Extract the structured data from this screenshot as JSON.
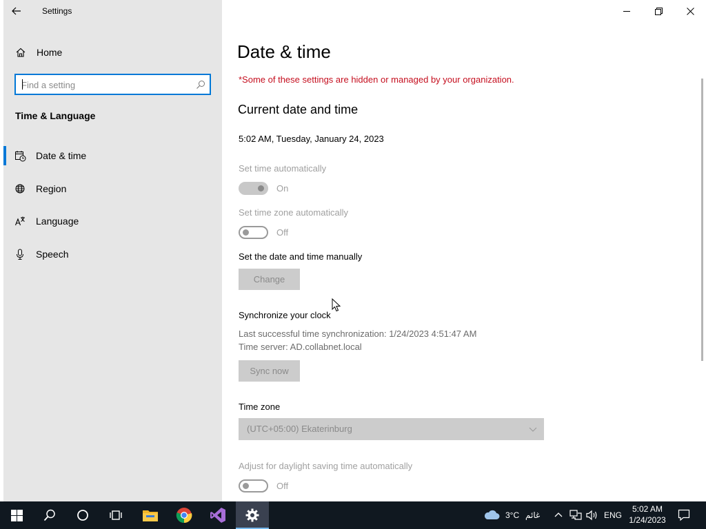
{
  "window": {
    "app_title": "Settings"
  },
  "sidebar": {
    "home_label": "Home",
    "search_placeholder": "Find a setting",
    "section_title": "Time & Language",
    "items": [
      {
        "label": "Date & time",
        "icon": "calendar-clock-icon",
        "selected": true
      },
      {
        "label": "Region",
        "icon": "globe-icon",
        "selected": false
      },
      {
        "label": "Language",
        "icon": "language-icon",
        "selected": false
      },
      {
        "label": "Speech",
        "icon": "microphone-icon",
        "selected": false
      }
    ]
  },
  "main": {
    "page_title": "Date & time",
    "org_notice": "*Some of these settings are hidden or managed by your organization.",
    "current_title": "Current date and time",
    "current_datetime": "5:02 AM, Tuesday, January 24, 2023",
    "set_time_auto": {
      "label": "Set time automatically",
      "state": "On"
    },
    "set_tz_auto": {
      "label": "Set time zone automatically",
      "state": "Off"
    },
    "manual": {
      "label": "Set the date and time manually",
      "button": "Change"
    },
    "sync": {
      "title": "Synchronize your clock",
      "last_sync": "Last successful time synchronization: 1/24/2023 4:51:47 AM",
      "server": "Time server: AD.collabnet.local",
      "button": "Sync now"
    },
    "timezone": {
      "label": "Time zone",
      "value": "(UTC+05:00) Ekaterinburg"
    },
    "dst": {
      "label": "Adjust for daylight saving time automatically",
      "state": "Off"
    }
  },
  "taskbar": {
    "weather_temp": "3°C",
    "weather_text": "غائم",
    "language": "ENG",
    "time": "5:02 AM",
    "date": "1/24/2023"
  },
  "colors": {
    "accent": "#0078d7",
    "warning": "#c50f1f",
    "taskbar": "#101820"
  }
}
